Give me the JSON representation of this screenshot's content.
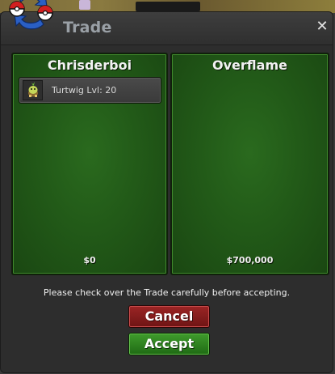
{
  "window": {
    "title": "Trade",
    "close_glyph": "✕"
  },
  "left_panel": {
    "player_name": "Chrisderboi",
    "pokemon": [
      {
        "icon": "turtwig-sprite-icon",
        "label": "Turtwig  Lvl: 20"
      }
    ],
    "money": "$0"
  },
  "right_panel": {
    "player_name": "Overflame",
    "pokemon": [],
    "money": "$700,000"
  },
  "notice": "Please check over the Trade carefully before accepting.",
  "buttons": {
    "cancel": "Cancel",
    "accept": "Accept"
  },
  "colors": {
    "panel_green": "#225a18",
    "cancel_red": "#8a1e1e",
    "accept_green": "#2f8a20"
  }
}
